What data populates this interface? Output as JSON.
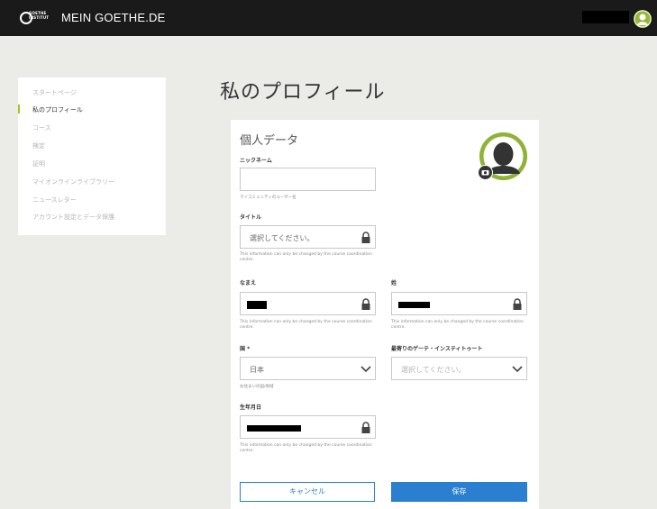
{
  "header": {
    "logo_text": "GOETHE INSTITUT",
    "site_title": "MEIN GOETHE.DE"
  },
  "sidebar": {
    "items": [
      {
        "label": "スタートページ",
        "active": false
      },
      {
        "label": "私のプロフィール",
        "active": true
      },
      {
        "label": "コース",
        "active": false
      },
      {
        "label": "検定",
        "active": false
      },
      {
        "label": "証明",
        "active": false
      },
      {
        "label": "マイオンラインライブラリー",
        "active": false
      },
      {
        "label": "ニュースレター",
        "active": false
      },
      {
        "label": "アカウント設定とデータ保護",
        "active": false
      }
    ]
  },
  "page": {
    "title": "私のプロフィール"
  },
  "form": {
    "section_title": "個人データ",
    "nickname": {
      "label": "ニックネーム",
      "value": "",
      "hint": "マイコミュニティのユーザー名"
    },
    "title_field": {
      "label": "タイトル",
      "placeholder": "選択してください。",
      "hint": "This information can only be changed by the course coordination centre."
    },
    "first_name": {
      "label": "なまえ",
      "hint": "This information can only be changed by the course coordination centre."
    },
    "last_name": {
      "label": "姓",
      "hint": "This information can only be changed by the course coordination centre."
    },
    "country": {
      "label": "国 *",
      "value": "日本",
      "hint": "お住まいの国/地域"
    },
    "institute": {
      "label": "最寄りのゲーテ・インスティトゥート",
      "placeholder": "選択してください。"
    },
    "birthdate": {
      "label": "生年月日",
      "hint": "This information can only be changed by the course coordination centre."
    },
    "buttons": {
      "cancel": "キャンセル",
      "save": "保存"
    }
  },
  "colors": {
    "topbar": "#1a1a1a",
    "accent_blue": "#2a7fd1",
    "active_green": "#a0c814",
    "avatar_green": "#8fb336"
  }
}
